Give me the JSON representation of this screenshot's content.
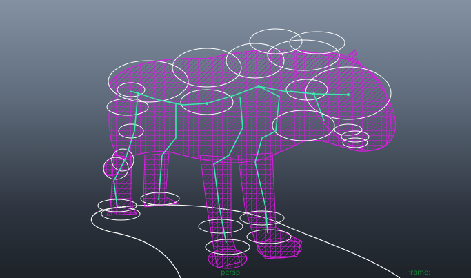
{
  "viewport": {
    "hud": {
      "camera_label": "persp",
      "frame_label": "Frame:"
    },
    "colors": {
      "mesh": "#d81ee0",
      "skeleton": "#3fe6b0",
      "controls": "#ffffff"
    }
  }
}
